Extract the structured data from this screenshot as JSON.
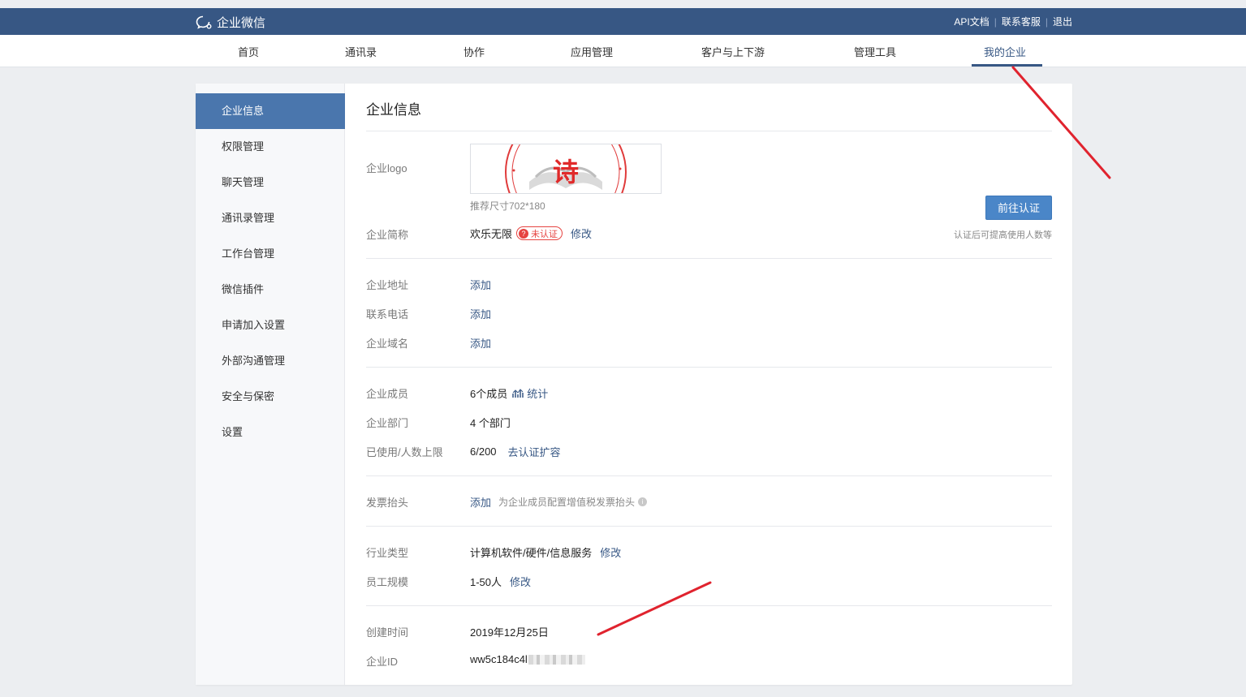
{
  "header": {
    "brand": "企业微信",
    "links": [
      "API文档",
      "联系客服",
      "退出"
    ],
    "separator": "|"
  },
  "nav": {
    "items": [
      "首页",
      "通讯录",
      "协作",
      "应用管理",
      "客户与上下游",
      "管理工具",
      "我的企业"
    ],
    "active": "我的企业"
  },
  "sidebar": {
    "items": [
      "企业信息",
      "权限管理",
      "聊天管理",
      "通讯录管理",
      "工作台管理",
      "微信插件",
      "申请加入设置",
      "外部沟通管理",
      "安全与保密",
      "设置"
    ],
    "active": "企业信息"
  },
  "main": {
    "title": "企业信息",
    "logo": {
      "label": "企业logo",
      "glyph": "诗",
      "size_hint": "推荐尺寸702*180"
    },
    "short_name": {
      "label": "企业简称",
      "value": "欢乐无限",
      "badge": "未认证",
      "badge_icon": "?",
      "action": "修改"
    },
    "verify_button": "前往认证",
    "verify_hint": "认证后可提高使用人数等",
    "address": {
      "label": "企业地址",
      "action": "添加"
    },
    "phone": {
      "label": "联系电话",
      "action": "添加"
    },
    "domain": {
      "label": "企业域名",
      "action": "添加"
    },
    "members": {
      "label": "企业成员",
      "value": "6个成员",
      "action": "统计"
    },
    "departments": {
      "label": "企业部门",
      "value": "4 个部门"
    },
    "usage": {
      "label": "已使用/人数上限",
      "value": "6/200",
      "action": "去认证扩容"
    },
    "invoice": {
      "label": "发票抬头",
      "action": "添加",
      "hint": "为企业成员配置增值税发票抬头",
      "info_icon": "i"
    },
    "industry": {
      "label": "行业类型",
      "value": "计算机软件/硬件/信息服务",
      "action": "修改"
    },
    "staff_size": {
      "label": "员工规模",
      "value": "1-50人",
      "action": "修改"
    },
    "created": {
      "label": "创建时间",
      "value": "2019年12月25日"
    },
    "corp_id": {
      "label": "企业ID",
      "value": "ww5c184c4l"
    }
  },
  "colors": {
    "header_bg": "#375784",
    "active_sidebar": "#4a76ad",
    "link": "#375784",
    "button": "#4a86c8",
    "badge": "#e64340",
    "annotation": "#e0232e"
  },
  "icons": [
    "chat-bubble-icon",
    "question-icon",
    "chart-icon",
    "info-icon"
  ]
}
